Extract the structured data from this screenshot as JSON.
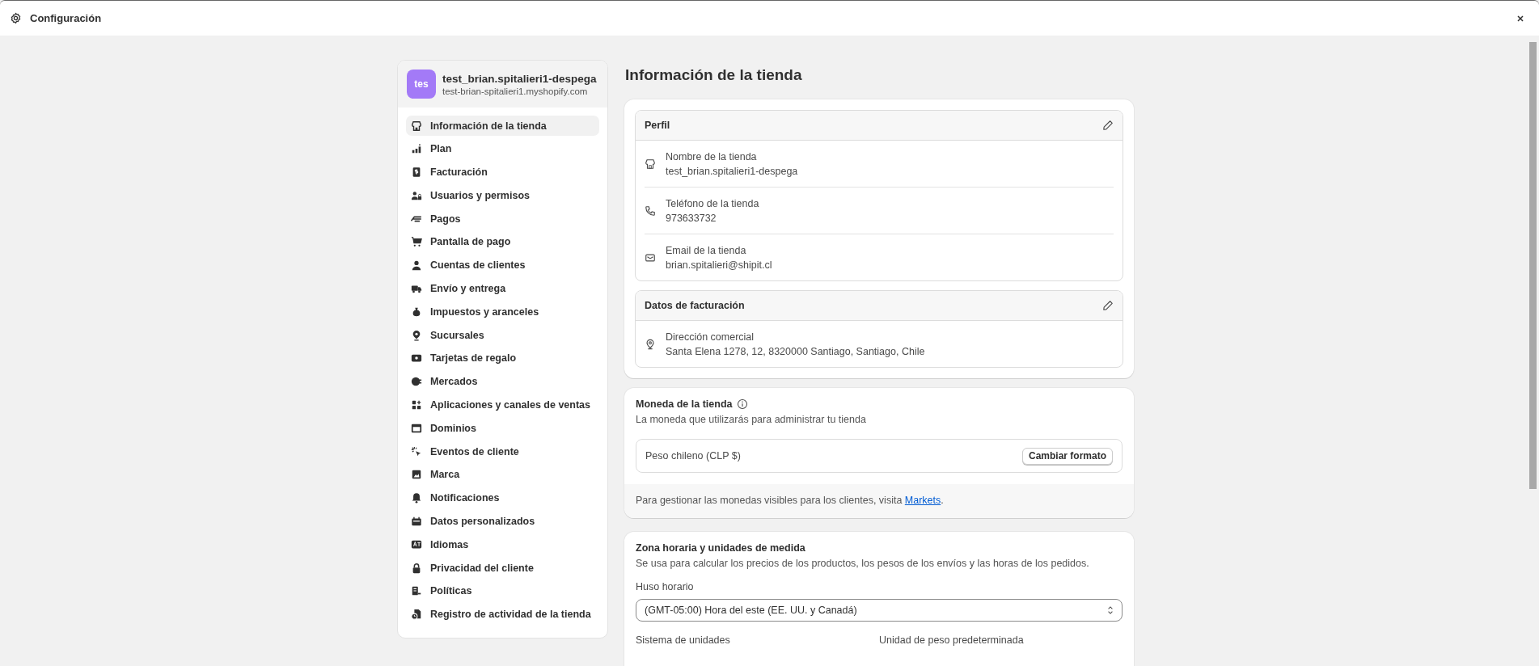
{
  "window": {
    "title": "Configuración"
  },
  "store": {
    "avatar": "tes",
    "name": "test_brian.spitalieri1-despega",
    "domain": "test-brian-spitalieri1.myshopify.com"
  },
  "nav": [
    {
      "label": "Información de la tienda",
      "selected": true
    },
    {
      "label": "Plan",
      "selected": false
    },
    {
      "label": "Facturación",
      "selected": false
    },
    {
      "label": "Usuarios y permisos",
      "selected": false
    },
    {
      "label": "Pagos",
      "selected": false
    },
    {
      "label": "Pantalla de pago",
      "selected": false
    },
    {
      "label": "Cuentas de clientes",
      "selected": false
    },
    {
      "label": "Envío y entrega",
      "selected": false
    },
    {
      "label": "Impuestos y aranceles",
      "selected": false
    },
    {
      "label": "Sucursales",
      "selected": false
    },
    {
      "label": "Tarjetas de regalo",
      "selected": false
    },
    {
      "label": "Mercados",
      "selected": false
    },
    {
      "label": "Aplicaciones y canales de ventas",
      "selected": false
    },
    {
      "label": "Dominios",
      "selected": false
    },
    {
      "label": "Eventos de cliente",
      "selected": false
    },
    {
      "label": "Marca",
      "selected": false
    },
    {
      "label": "Notificaciones",
      "selected": false
    },
    {
      "label": "Datos personalizados",
      "selected": false
    },
    {
      "label": "Idiomas",
      "selected": false
    },
    {
      "label": "Privacidad del cliente",
      "selected": false
    },
    {
      "label": "Políticas",
      "selected": false
    },
    {
      "label": "Registro de actividad de la tienda",
      "selected": false
    }
  ],
  "page_title": "Información de la tienda",
  "profile": {
    "title": "Perfil",
    "fields": [
      {
        "label": "Nombre de la tienda",
        "value": "test_brian.spitalieri1-despega"
      },
      {
        "label": "Teléfono de la tienda",
        "value": "973633732"
      },
      {
        "label": "Email de la tienda",
        "value": "brian.spitalieri@shipit.cl"
      }
    ]
  },
  "billing": {
    "title": "Datos de facturación",
    "fields": [
      {
        "label": "Dirección comercial",
        "value": "Santa Elena 1278, 12, 8320000 Santiago, Santiago, Chile"
      }
    ]
  },
  "currency": {
    "title": "Moneda de la tienda",
    "subtitle": "La moneda que utilizarás para administrar tu tienda",
    "value": "Peso chileno (CLP $)",
    "button": "Cambiar formato",
    "footer_text": "Para gestionar las monedas visibles para los clientes, visita ",
    "footer_link": "Markets",
    "footer_end": "."
  },
  "units": {
    "title": "Zona horaria y unidades de medida",
    "subtitle": "Se usa para calcular los precios de los productos, los pesos de los envíos y las horas de los pedidos.",
    "timezone_label": "Huso horario",
    "timezone_value": "(GMT-05:00) Hora del este (EE. UU. y Canadá)",
    "unit_system_label": "Sistema de unidades",
    "weight_unit_label": "Unidad de peso predeterminada"
  }
}
